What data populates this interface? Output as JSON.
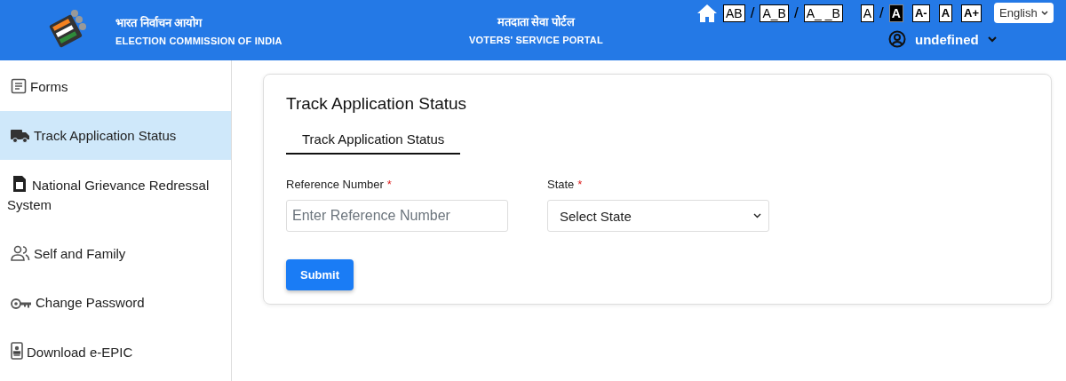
{
  "header": {
    "title_hindi": "भारत निर्वाचन आयोग",
    "title_english": "ELECTION COMMISSION OF INDIA",
    "portal_hindi": "मतदाता सेवा पोर्टल",
    "portal_english": "VOTERS' SERVICE PORTAL",
    "accessibility": [
      {
        "kind": "spacing",
        "label": "AB"
      },
      {
        "kind": "slash",
        "label": "/"
      },
      {
        "kind": "spacing",
        "label": "A_B"
      },
      {
        "kind": "slash",
        "label": "/"
      },
      {
        "kind": "spacing",
        "label": "A_ _B"
      },
      {
        "kind": "contrast",
        "label": "A",
        "selected": false
      },
      {
        "kind": "slash",
        "label": "/"
      },
      {
        "kind": "contrast",
        "label": "A",
        "selected": true
      },
      {
        "kind": "size",
        "label": "A-"
      },
      {
        "kind": "size",
        "label": "A"
      },
      {
        "kind": "size",
        "label": "A+"
      }
    ],
    "language": "English",
    "user": "undefined"
  },
  "sidebar": {
    "items": [
      {
        "label": "Forms",
        "selected": false
      },
      {
        "label": "Track Application Status",
        "selected": true
      },
      {
        "label": "National Grievance Redressal System",
        "selected": false
      },
      {
        "label": "Self and Family",
        "selected": false
      },
      {
        "label": "Change Password",
        "selected": false
      },
      {
        "label": "Download e-EPIC",
        "selected": false
      }
    ]
  },
  "card": {
    "title": "Track Application Status",
    "tabs": [
      {
        "label": "Track Application Status",
        "selected": true
      }
    ],
    "fields": [
      {
        "kind": "input",
        "label": "Reference Number",
        "required_mark": "*",
        "placeholder": "Enter Reference Number"
      },
      {
        "kind": "select",
        "label": "State",
        "required_mark": "*",
        "value": "Select State"
      }
    ],
    "submit": "Submit"
  }
}
